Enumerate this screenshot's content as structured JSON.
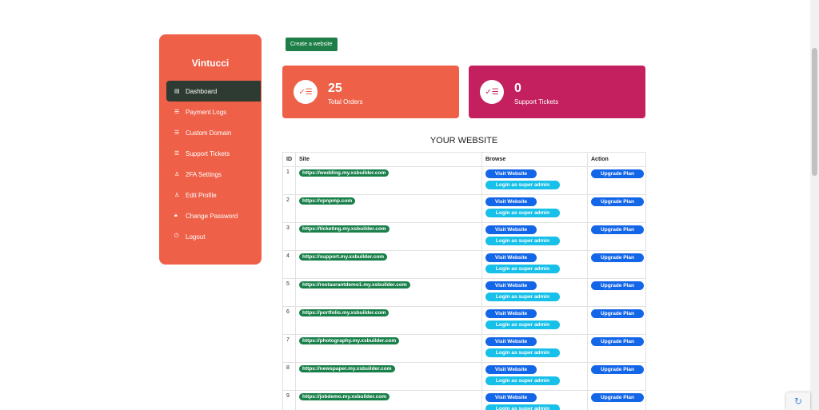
{
  "sidebar": {
    "brand": "Vintucci",
    "items": [
      {
        "label": "Dashboard",
        "icon": "grid-icon",
        "glyph": "▤"
      },
      {
        "label": "Payment Logs",
        "icon": "list-icon",
        "glyph": "☰"
      },
      {
        "label": "Custom Domain",
        "icon": "list-icon",
        "glyph": "☰"
      },
      {
        "label": "Support Tickets",
        "icon": "list-icon",
        "glyph": "☰"
      },
      {
        "label": "2FA Settings",
        "icon": "user-icon",
        "glyph": "♙"
      },
      {
        "label": "Edit Profile",
        "icon": "user-icon",
        "glyph": "♙"
      },
      {
        "label": "Change Password",
        "icon": "lock-icon",
        "glyph": "🔒︎"
      },
      {
        "label": "Logout",
        "icon": "power-icon",
        "glyph": "⏻"
      }
    ]
  },
  "toolbar": {
    "create_label": "Create a website"
  },
  "stats": {
    "orders": {
      "value": "25",
      "label": "Total Orders",
      "glyph": "✓☰"
    },
    "tickets": {
      "value": "0",
      "label": "Support Tickets",
      "glyph": "✓☰"
    }
  },
  "section_title": "YOUR WEBSITE",
  "table": {
    "headers": {
      "id": "ID",
      "site": "Site",
      "browse": "Browse",
      "action": "Action"
    },
    "visit_label": "Visit Website",
    "login_label": "Login as super admin",
    "upgrade_label": "Upgrade Plan",
    "rows": [
      {
        "id": "1",
        "site": "https://wedding.my.xsbuilder.com"
      },
      {
        "id": "2",
        "site": "https://vpnpmp.com"
      },
      {
        "id": "3",
        "site": "https://ticketing.my.xsbuilder.com"
      },
      {
        "id": "4",
        "site": "https://support.my.xsbuilder.com"
      },
      {
        "id": "5",
        "site": "https://restaurantdemo1.my.xsbuilder.com"
      },
      {
        "id": "6",
        "site": "https://portfolio.my.xsbuilder.com"
      },
      {
        "id": "7",
        "site": "https://photography.my.xsbuilder.com"
      },
      {
        "id": "8",
        "site": "https://newspaper.my.xsbuilder.com"
      },
      {
        "id": "9",
        "site": "https://jobdemo.my.xsbuilder.com"
      }
    ]
  },
  "colors": {
    "sidebar": "#ee6047",
    "active_item": "#2d3b32",
    "orders_card": "#ee6047",
    "tickets_card": "#c41f5e",
    "site_pill": "#19804a",
    "visit_pill": "#1466e8",
    "login_pill": "#17c0e8"
  }
}
